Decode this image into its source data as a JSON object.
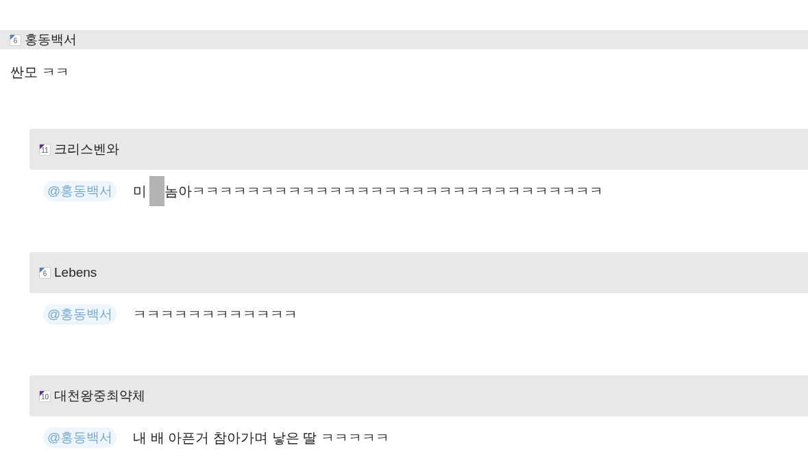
{
  "post": {
    "author": "홍동백서",
    "badge": {
      "rank": "6",
      "color": "#4a7ab8"
    },
    "text": "싼모 ㅋㅋ"
  },
  "replies": [
    {
      "author": "크리스벤와",
      "badge": {
        "rank": "11",
        "color": "#5a2d91"
      },
      "mention": "@홍동백서",
      "text_before": "미",
      "redacted": true,
      "text_after": "놈아ㅋㅋㅋㅋㅋㅋㅋㅋㅋㅋㅋㅋㅋㅋㅋㅋㅋㅋㅋㅋㅋㅋㅋㅋㅋㅋㅋㅋㅋㅋ"
    },
    {
      "author": "Lebens",
      "badge": {
        "rank": "6",
        "color": "#4a7ab8"
      },
      "mention": "@홍동백서",
      "text_before": "ㅋㅋㅋㅋㅋㅋㅋㅋㅋㅋㅋㅋ",
      "redacted": false
    },
    {
      "author": "대천왕중최약체",
      "badge": {
        "rank": "10",
        "color": "#5a2d91"
      },
      "mention": "@홍동백서",
      "text_before": "내 배 아픈거 참아가며 낳은 딸 ㅋㅋㅋㅋㅋ",
      "redacted": false
    }
  ]
}
